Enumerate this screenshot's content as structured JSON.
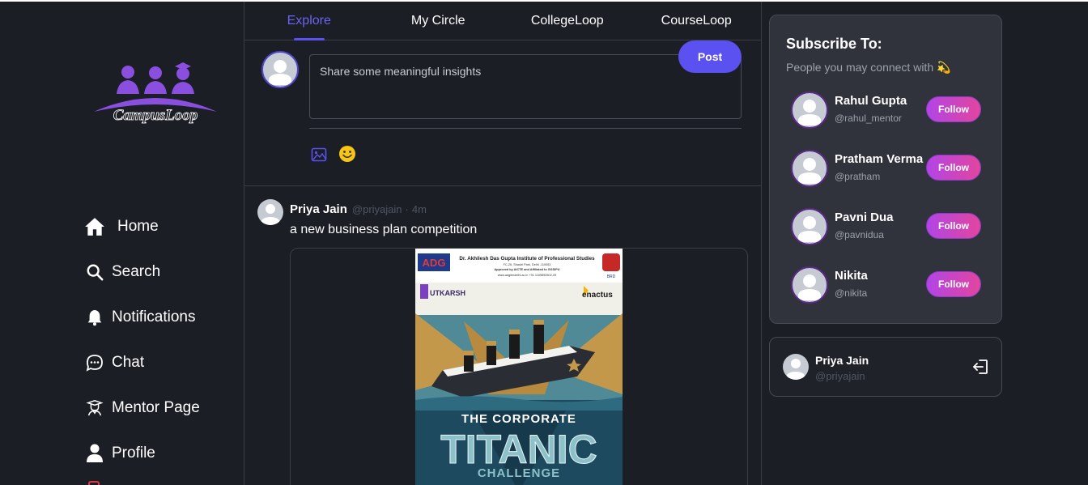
{
  "brand": {
    "logo_text": "CampusLoop"
  },
  "sidebar": {
    "items": [
      {
        "label": "Home",
        "icon": "home-icon"
      },
      {
        "label": "Search",
        "icon": "search-icon"
      },
      {
        "label": "Notifications",
        "icon": "bell-icon"
      },
      {
        "label": "Chat",
        "icon": "chat-icon"
      },
      {
        "label": "Mentor Page",
        "icon": "mentor-icon"
      },
      {
        "label": "Profile",
        "icon": "user-icon"
      }
    ]
  },
  "tabs": [
    {
      "label": "Explore",
      "active": true
    },
    {
      "label": "My Circle",
      "active": false
    },
    {
      "label": "CollegeLoop",
      "active": false
    },
    {
      "label": "CourseLoop",
      "active": false
    }
  ],
  "composer": {
    "placeholder": "Share some meaningful insights",
    "post_label": "Post"
  },
  "post": {
    "author": "Priya Jain",
    "handle": "@priyajain",
    "separator": "·",
    "time": "4m",
    "text": "a new business plan competition",
    "poster": {
      "institute": "Dr. Akhilesh Das Gupta Institute of Professional Studies",
      "address": "FC-26, Shastri Park, Delhi -110053",
      "approval": "Approved by AICTE and Affiliated to GGSIPU",
      "contact": "www.adgitmdelhi.ac.in   +91 1169890502-09",
      "adg": "ADG",
      "brd": "BRD",
      "club_left": "UTKARSH",
      "club_right": "enactus",
      "headline_top": "THE CORPORATE",
      "headline_main": "TITANIC",
      "headline_bottom": "CHALLENGE"
    }
  },
  "subscribe": {
    "title": "Subscribe To:",
    "subtitle": "People you may connect with",
    "subtitle_emoji": "💫",
    "follow_label": "Follow",
    "people": [
      {
        "name": "Rahul Gupta",
        "handle": "@rahul_mentor"
      },
      {
        "name": "Pratham Verma",
        "handle": "@pratham"
      },
      {
        "name": "Pavni Dua",
        "handle": "@pavnidua"
      },
      {
        "name": "Nikita",
        "handle": "@nikita"
      }
    ]
  },
  "current_user": {
    "name": "Priya Jain",
    "handle": "@priyajain"
  },
  "colors": {
    "background": "#1b1e25",
    "accent": "#5b50f0",
    "follow_gradient_start": "#b245e6",
    "follow_gradient_end": "#e2459e",
    "logo_purple": "#8b4fe0"
  }
}
